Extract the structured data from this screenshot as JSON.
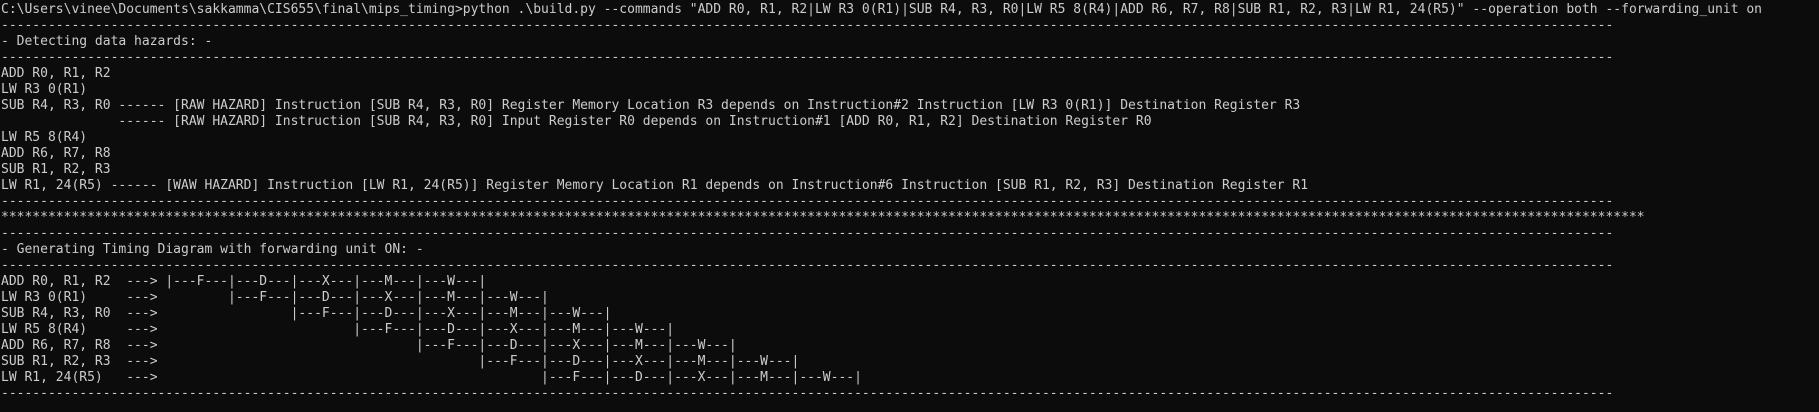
{
  "console": {
    "lines": [
      "C:\\Users\\vinee\\Documents\\sakkamma\\CIS655\\final\\mips_timing>python .\\build.py --commands \"ADD R0, R1, R2|LW R3 0(R1)|SUB R4, R3, R0|LW R5 8(R4)|ADD R6, R7, R8|SUB R1, R2, R3|LW R1, 24(R5)\" --operation both --forwarding_unit on",
      "--------------------------------------------------------------------------------------------------------------------------------------------------------------------------------------------------------------",
      "- Detecting data hazards: -",
      "--------------------------------------------------------------------------------------------------------------------------------------------------------------------------------------------------------------",
      "ADD R0, R1, R2",
      "LW R3 0(R1)",
      "SUB R4, R3, R0 ------ [RAW HAZARD] Instruction [SUB R4, R3, R0] Register Memory Location R3 depends on Instruction#2 Instruction [LW R3 0(R1)] Destination Register R3",
      "               ------ [RAW HAZARD] Instruction [SUB R4, R3, R0] Input Register R0 depends on Instruction#1 [ADD R0, R1, R2] Destination Register R0",
      "LW R5 8(R4)",
      "ADD R6, R7, R8",
      "SUB R1, R2, R3",
      "LW R1, 24(R5) ------ [WAW HAZARD] Instruction [LW R1, 24(R5)] Register Memory Location R1 depends on Instruction#6 Instruction [SUB R1, R2, R3] Destination Register R1",
      "--------------------------------------------------------------------------------------------------------------------------------------------------------------------------------------------------------------",
      "******************************************************************************************************************************************************************************************************************",
      "--------------------------------------------------------------------------------------------------------------------------------------------------------------------------------------------------------------",
      "- Generating Timing Diagram with forwarding unit ON: -",
      "--------------------------------------------------------------------------------------------------------------------------------------------------------------------------------------------------------------",
      "ADD R0, R1, R2  ---> |---F---|---D---|---X---|---M---|---W---|",
      "LW R3 0(R1)     --->         |---F---|---D---|---X---|---M---|---W---|",
      "SUB R4, R3, R0  --->                 |---F---|---D---|---X---|---M---|---W---|",
      "LW R5 8(R4)     --->                         |---F---|---D---|---X---|---M---|---W---|",
      "ADD R6, R7, R8  --->                                 |---F---|---D---|---X---|---M---|---W---|",
      "SUB R1, R2, R3  --->                                         |---F---|---D---|---X---|---M---|---W---|",
      "LW R1, 24(R5)   --->                                                 |---F---|---D---|---X---|---M---|---W---|",
      "--------------------------------------------------------------------------------------------------------------------------------------------------------------------------------------------------------------"
    ]
  }
}
